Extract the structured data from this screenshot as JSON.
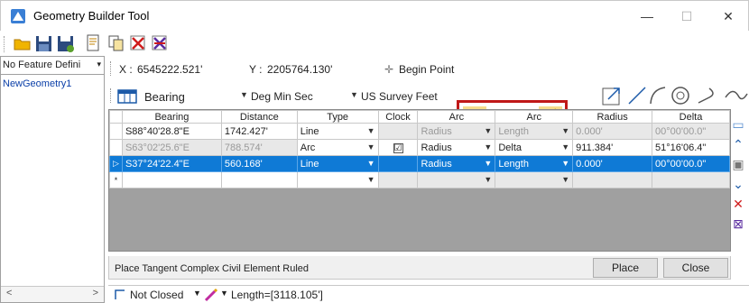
{
  "window": {
    "title": "Geometry Builder Tool",
    "minimize": "—",
    "maximize": "☐",
    "close": "✕"
  },
  "toolbar": {
    "icons": [
      "open-folder-icon",
      "save-icon",
      "save-as-icon",
      "new-icon",
      "copy-icon",
      "delete-icon",
      "delete-all-icon"
    ]
  },
  "left_panel": {
    "feature_definition": "No Feature Defini",
    "geometry_item": "NewGeometry1"
  },
  "coords": {
    "x_label": "X :",
    "x_value": "6545222.521'",
    "y_label": "Y :",
    "y_value": "2205764.130'",
    "begin_label": "Begin Point",
    "begin_icon": "✛"
  },
  "settings": {
    "bearing": "Bearing",
    "angle_format": "Deg Min Sec",
    "units": "US Survey Feet"
  },
  "grid": {
    "columns": [
      "Bearing",
      "Distance",
      "Type",
      "Clock",
      "Arc",
      "Arc",
      "Radius",
      "Delta"
    ],
    "rows": [
      {
        "marker": "",
        "bearing": "S88°40'28.8\"E",
        "distance": "1742.427'",
        "type": "Line",
        "clock": "",
        "arc1": "Radius",
        "arc2": "Length",
        "radius": "0.000'",
        "delta": "00°00'00.0\""
      },
      {
        "marker": "",
        "bearing": "S63°02'25.6\"E",
        "distance": "788.574'",
        "type": "Arc",
        "clock": "☑",
        "arc1": "Radius",
        "arc2": "Delta",
        "radius": "911.384'",
        "delta": "51°16'06.4\""
      },
      {
        "marker": "▷",
        "bearing": "S37°24'22.4\"E",
        "distance": "560.168'",
        "type": "Line",
        "clock": "",
        "arc1": "Radius",
        "arc2": "Length",
        "radius": "0.000'",
        "delta": "00°00'00.0\""
      },
      {
        "marker": "*",
        "bearing": "",
        "distance": "",
        "type": "",
        "clock": "",
        "arc1": "",
        "arc2": "",
        "radius": "",
        "delta": ""
      }
    ]
  },
  "status": {
    "prompt": "Place Tangent Complex Civil Element Ruled",
    "place": "Place",
    "close": "Close"
  },
  "bottom": {
    "closed_state": "Not Closed",
    "length": "Length=[3118.105']"
  }
}
